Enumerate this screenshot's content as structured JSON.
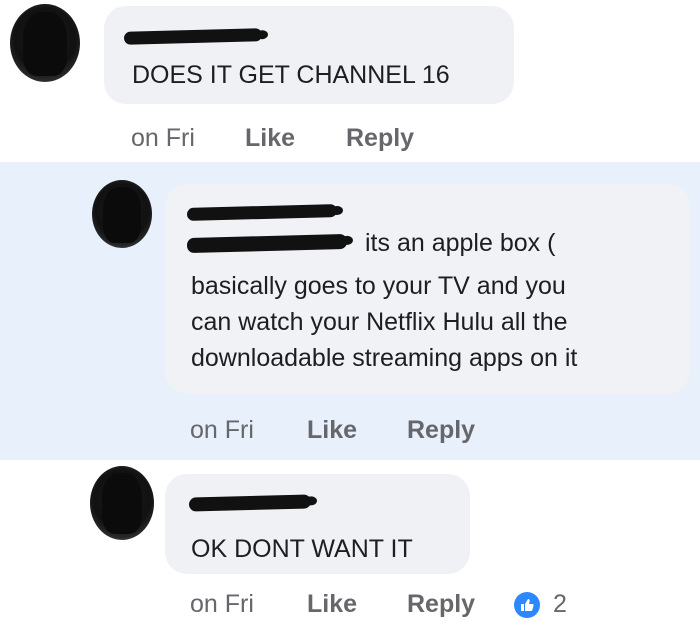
{
  "comments": [
    {
      "text_lines": [
        "DOES IT GET CHANNEL 16"
      ],
      "time": "on Fri",
      "like_label": "Like",
      "reply_label": "Reply"
    },
    {
      "mention_suffix": "its an apple box (",
      "text_lines": [
        "basically goes to your TV and you",
        "can watch your Netflix Hulu all the",
        "downloadable streaming apps on it"
      ],
      "time": "on Fri",
      "like_label": "Like",
      "reply_label": "Reply"
    },
    {
      "text_lines": [
        "OK DONT WANT IT"
      ],
      "time": "on Fri",
      "like_label": "Like",
      "reply_label": "Reply",
      "reaction_count": "2"
    }
  ],
  "colors": {
    "highlight_background": "#e7f0fb",
    "bubble": "#eff1f4",
    "meta_text": "#65676b",
    "like_blue": "#2d88ff"
  },
  "icons": {
    "reaction": "thumbs-up-icon"
  }
}
